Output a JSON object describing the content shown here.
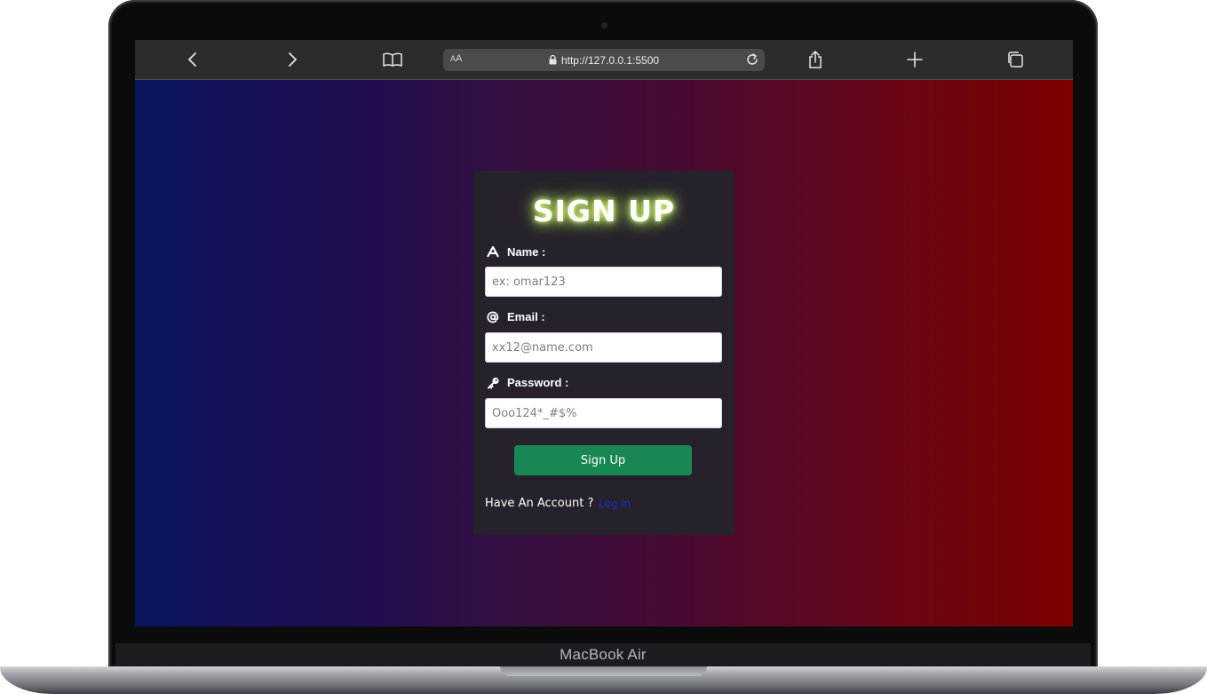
{
  "browser": {
    "url": "http://127.0.0.1:5500",
    "text_size_label_small": "A",
    "text_size_label_large": "A"
  },
  "form": {
    "title": "SIGN UP",
    "name_label": "Name :",
    "name_placeholder": "ex: omar123",
    "email_label": "Email :",
    "email_placeholder": "xx12@name.com",
    "password_label": "Password :",
    "password_placeholder": "Ooo124*_#$%",
    "submit_label": "Sign Up",
    "have_account_text": "Have An Account ?",
    "login_link": "Log In"
  },
  "device": {
    "brand_label": "MacBook Air"
  },
  "colors": {
    "submit_button": "#198754",
    "title_glow": "#c9ff6a",
    "card_background": "#26212b",
    "gradient_left": "#0a1560",
    "gradient_right": "#7c0000"
  },
  "icons": {
    "name": "letter-a-icon",
    "email": "at-sign-icon",
    "password": "key-icon"
  }
}
